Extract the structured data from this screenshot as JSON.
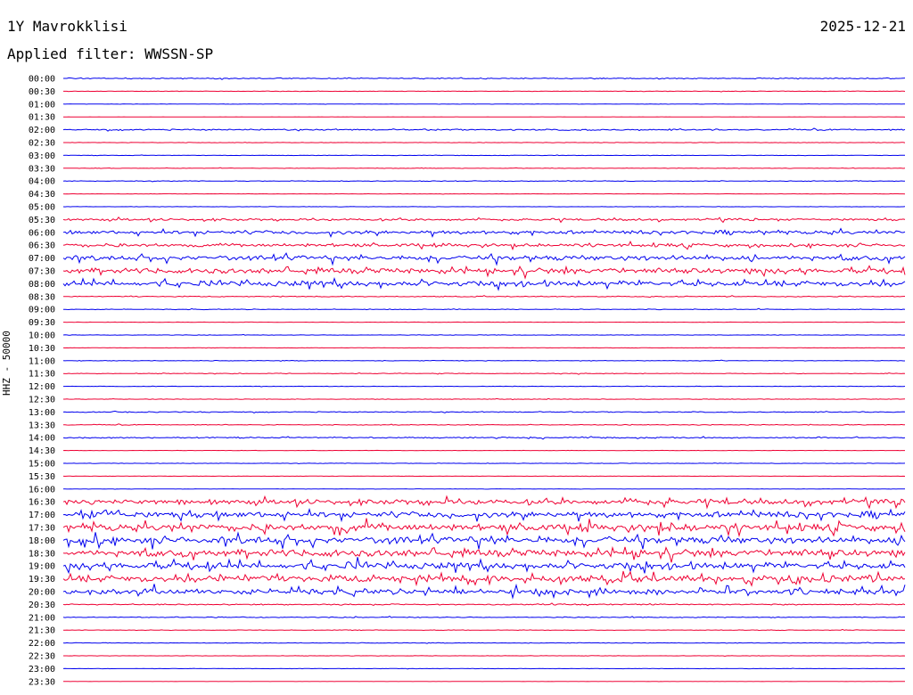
{
  "header": {
    "station": "1Y Mavrokklisi",
    "date": "2025-12-21",
    "filter_text": "Applied filter: WWSSN-SP"
  },
  "chart_data": {
    "type": "line",
    "title": "1Y Mavrokklisi",
    "date": "2025-12-21",
    "filter": "WWSSN-SP",
    "ylabel": "HHZ - 50000",
    "xlabel": "",
    "row_duration_minutes": 30,
    "row_labels": [
      "00:00",
      "00:30",
      "01:00",
      "01:30",
      "02:00",
      "02:30",
      "03:00",
      "03:30",
      "04:00",
      "04:30",
      "05:00",
      "05:30",
      "06:00",
      "06:30",
      "07:00",
      "07:30",
      "08:00",
      "08:30",
      "09:00",
      "09:30",
      "10:00",
      "10:30",
      "11:00",
      "11:30",
      "12:00",
      "12:30",
      "13:00",
      "13:30",
      "14:00",
      "14:30",
      "15:00",
      "15:30",
      "16:00",
      "16:30",
      "17:00",
      "17:30",
      "18:00",
      "18:30",
      "19:00",
      "19:30",
      "20:00",
      "20:30",
      "21:00",
      "21:30",
      "22:00",
      "22:30",
      "23:00",
      "23:30"
    ],
    "series_colors": [
      "#0000ee",
      "#ee0033"
    ],
    "activity": [
      0.1,
      0.05,
      0.03,
      0.02,
      0.12,
      0.04,
      0.04,
      0.05,
      0.06,
      0.03,
      0.03,
      0.18,
      0.3,
      0.28,
      0.4,
      0.42,
      0.45,
      0.08,
      0.06,
      0.03,
      0.04,
      0.03,
      0.05,
      0.06,
      0.04,
      0.05,
      0.08,
      0.07,
      0.1,
      0.03,
      0.04,
      0.03,
      0.03,
      0.4,
      0.48,
      0.55,
      0.55,
      0.55,
      0.55,
      0.55,
      0.45,
      0.1,
      0.08,
      0.05,
      0.05,
      0.03,
      0.03,
      0.02
    ],
    "grid": false,
    "legend": "none"
  }
}
